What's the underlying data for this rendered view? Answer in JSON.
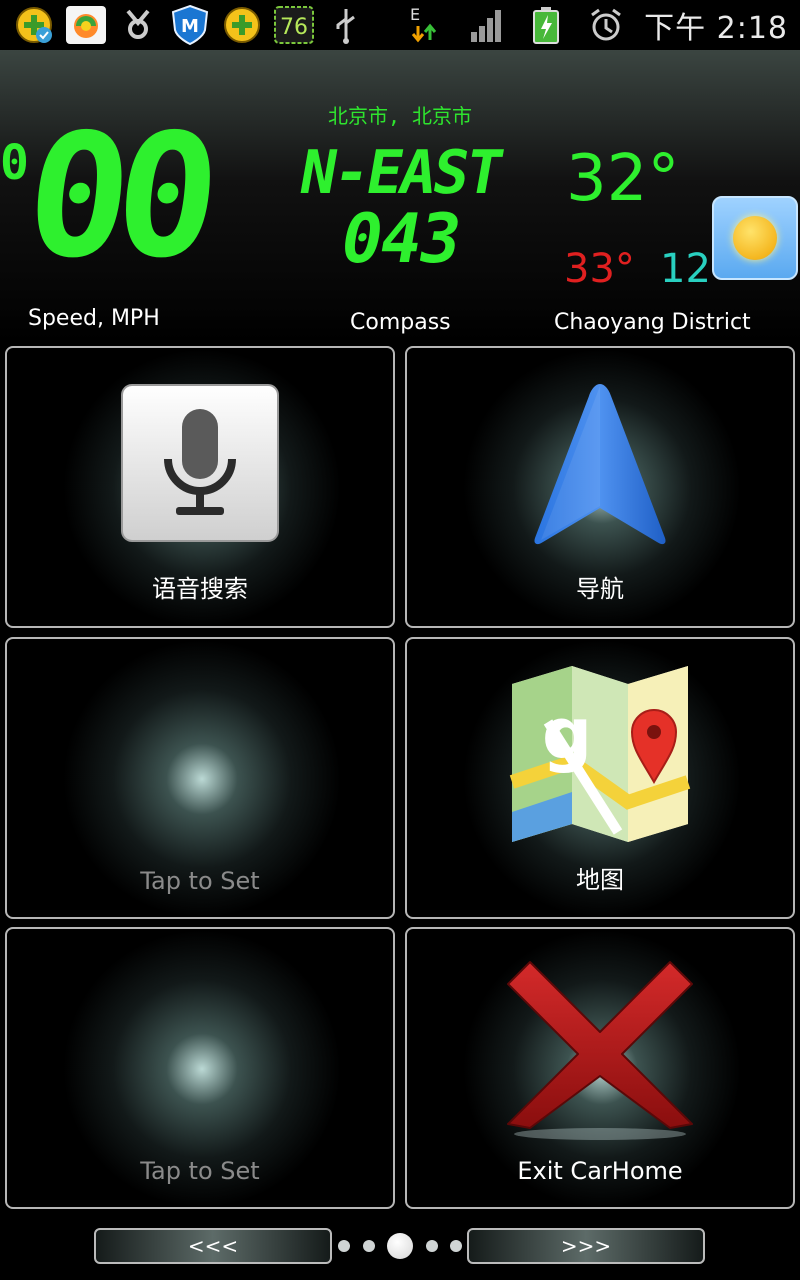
{
  "status_bar": {
    "time": "下午 2:18",
    "badge_number": "76",
    "network_type": "E",
    "icons": [
      "app-badge-icon",
      "store-icon",
      "usb-icon",
      "shield-icon",
      "plus-icon",
      "notification-76-icon",
      "usb-debug-icon",
      "data-arrows-icon",
      "signal-icon",
      "battery-charging-icon",
      "alarm-icon"
    ]
  },
  "dashboard": {
    "location": "北京市, 北京市",
    "speed_small": "0",
    "speed_big": "00",
    "speed_label": "Speed, MPH",
    "compass_direction": "N-EAST",
    "compass_degrees": "043",
    "compass_label": "Compass",
    "temperature_current": "32°",
    "temperature_high": "33°",
    "temperature_low": "12°",
    "district_label": "Chaoyang District",
    "weather_icon": "sun-icon"
  },
  "tiles": [
    {
      "label": "语音搜索",
      "icon": "microphone-icon"
    },
    {
      "label": "导航",
      "icon": "navigation-arrow-icon"
    },
    {
      "label": "Tap to Set",
      "icon": ""
    },
    {
      "label": "地图",
      "icon": "google-maps-icon"
    },
    {
      "label": "Tap to Set",
      "icon": ""
    },
    {
      "label": "Exit CarHome",
      "icon": "close-x-icon"
    }
  ],
  "bottom_nav": {
    "prev_label": "<<<",
    "next_label": ">>>",
    "page_count": 5,
    "active_page": 3
  },
  "colors": {
    "digital_green": "#2ef02e",
    "high_temp_red": "#e02020",
    "low_temp_cyan": "#29d0c0"
  }
}
